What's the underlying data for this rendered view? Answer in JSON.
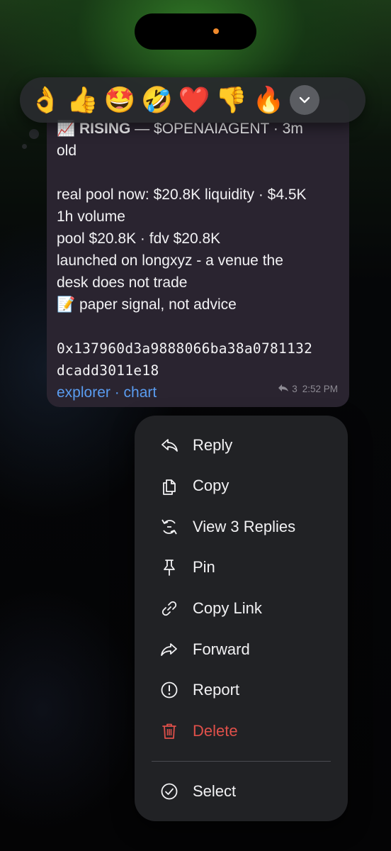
{
  "reactions": [
    {
      "name": "ok-hand-emoji",
      "glyph": "👌"
    },
    {
      "name": "thumbs-up-emoji",
      "glyph": "👍"
    },
    {
      "name": "star-struck-emoji",
      "glyph": "🤩"
    },
    {
      "name": "rofl-emoji",
      "glyph": "🤣"
    },
    {
      "name": "heart-emoji",
      "glyph": "❤️"
    },
    {
      "name": "thumbs-down-emoji",
      "glyph": "👎"
    },
    {
      "name": "fire-emoji",
      "glyph": "🔥"
    }
  ],
  "message": {
    "header_icon": "📈",
    "header_bold": "RISING",
    "header_rest": " — $OPENAIAGENT · 3m",
    "line_2": "old",
    "line_3": "real pool now: $20.8K liquidity · $4.5K",
    "line_4": "1h volume",
    "line_5": "pool $20.8K · fdv $20.8K",
    "line_6": "launched on longxyz - a venue the",
    "line_7": "desk does not trade",
    "note_icon": "📝",
    "line_8": " paper signal, not advice",
    "address_1": "0x137960d3a9888066ba38a0781132",
    "address_2": "dcadd3011e18",
    "link_explorer": "explorer",
    "link_sep": " · ",
    "link_chart": "chart",
    "reply_count": "3",
    "time": "2:52 PM"
  },
  "menu": {
    "reply": "Reply",
    "copy": "Copy",
    "view_replies": "View 3 Replies",
    "pin": "Pin",
    "copy_link": "Copy Link",
    "forward": "Forward",
    "report": "Report",
    "delete": "Delete",
    "select": "Select"
  },
  "colors": {
    "accent_link": "#5a9cf0",
    "danger": "#e0504a",
    "bubble": "#2a2430"
  }
}
